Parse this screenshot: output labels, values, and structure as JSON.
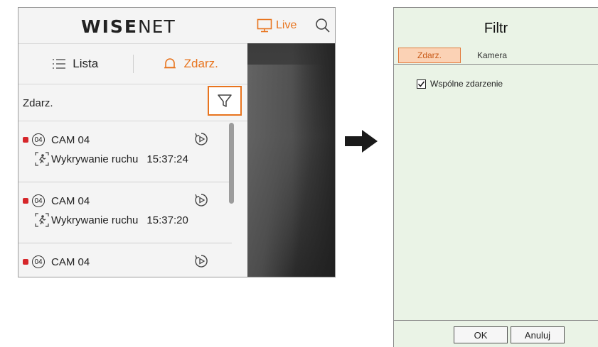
{
  "app": {
    "logo_bold": "WISE",
    "logo_thin": "NET",
    "live_label": "Live"
  },
  "tabs": [
    {
      "label": "Lista"
    },
    {
      "label": "Zdarz."
    }
  ],
  "filter_row": {
    "label": "Zdarz."
  },
  "events": [
    {
      "channel": "04",
      "camera": "CAM 04",
      "event": "Wykrywanie ruchu",
      "time": "15:37:24"
    },
    {
      "channel": "04",
      "camera": "CAM 04",
      "event": "Wykrywanie ruchu",
      "time": "15:37:20"
    },
    {
      "channel": "04",
      "camera": "CAM 04",
      "event": "",
      "time": ""
    }
  ],
  "dialog": {
    "title": "Filtr",
    "tabs": [
      {
        "label": "Zdarz.",
        "active": true
      },
      {
        "label": "Kamera",
        "active": false
      }
    ],
    "checkbox_label": "Wspólne zdarzenie",
    "checkbox_checked": true,
    "ok_label": "OK",
    "cancel_label": "Anuluj"
  },
  "colors": {
    "accent": "#e8741e",
    "record": "#d6262a",
    "dialog_bg": "#eaf3e6",
    "tab_active_bg": "#fbd2b5"
  }
}
